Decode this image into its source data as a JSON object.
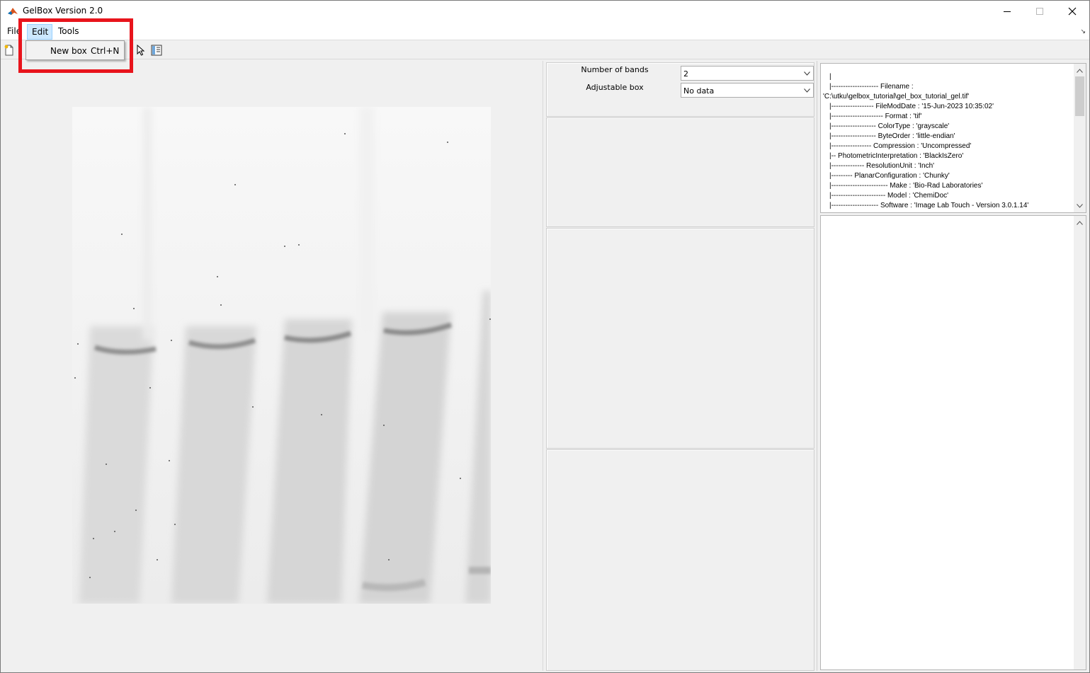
{
  "window": {
    "title": "GelBox Version 2.0"
  },
  "menubar": {
    "file": "File",
    "edit": "Edit",
    "tools": "Tools",
    "right_glyph": "↘"
  },
  "edit_menu": {
    "items": [
      {
        "label": "New box",
        "shortcut": "Ctrl+N"
      }
    ]
  },
  "toolbar": {
    "buttons": [
      "new-file-icon",
      "pointer-icon",
      "inspector-icon"
    ]
  },
  "controls": {
    "number_of_bands_label": "Number of bands",
    "number_of_bands_value": "2",
    "adjustable_box_label": "Adjustable box",
    "adjustable_box_value": "No data"
  },
  "info": {
    "lines": [
      "|",
      "|-------------------- Filename :",
      "'C:\\utku\\gelbox_tutorial\\gel_box_tutorial_gel.tif'",
      "|------------------ FileModDate : '15-Jun-2023 10:35:02'",
      "|---------------------- Format : 'tif'",
      "|------------------- ColorType : 'grayscale'",
      "|------------------- ByteOrder : 'little-endian'",
      "|----------------- Compression : 'Uncompressed'",
      "|-- PhotometricInterpretation : 'BlackIsZero'",
      "|-------------- ResolutionUnit : 'Inch'",
      "|--------- PlanarConfiguration : 'Chunky'",
      "|------------------------ Make : 'Bio-Rad Laboratories'",
      "|----------------------- Model : 'ChemiDoc'",
      "|-------------------- Software : 'Image Lab Touch - Version 3.0.1.14'"
    ]
  },
  "colors": {
    "menu_highlight": "#cce8ff",
    "annotation_red": "#e8141c"
  }
}
